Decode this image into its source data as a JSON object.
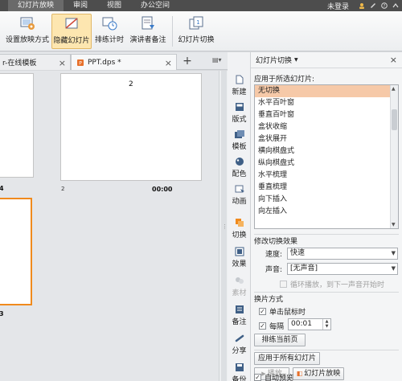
{
  "menu": {
    "items": [
      "幻灯片放映",
      "审阅",
      "视图",
      "办公空间"
    ],
    "active_index": 0,
    "login": "未登录"
  },
  "ribbon": {
    "buttons": [
      {
        "label": "设置放映方式",
        "icon": "slideshow-settings-icon"
      },
      {
        "label": "隐藏幻灯片",
        "icon": "hide-slide-icon",
        "selected": true
      },
      {
        "label": "排练计时",
        "icon": "rehearse-timing-icon"
      },
      {
        "label": "演讲者备注",
        "icon": "speaker-notes-icon"
      },
      {
        "label": "幻灯片切换",
        "icon": "slide-transition-icon"
      }
    ]
  },
  "tabs": [
    {
      "label": "r-在线模板",
      "active": false
    },
    {
      "label": "PPT.dps *",
      "active": true
    }
  ],
  "slides": {
    "slide2": {
      "number": "2",
      "index": "2",
      "time": "00:00"
    },
    "slide1_index_fragment": "4",
    "slide3_index_fragment": "3"
  },
  "sidebar": {
    "items": [
      {
        "label": "新建",
        "icon": "new-icon"
      },
      {
        "label": "版式",
        "icon": "layout-icon"
      },
      {
        "label": "模板",
        "icon": "template-icon"
      },
      {
        "label": "配色",
        "icon": "color-scheme-icon"
      },
      {
        "label": "动画",
        "icon": "animation-icon"
      },
      {
        "label": "切换",
        "icon": "transition-icon"
      },
      {
        "label": "效果",
        "icon": "effects-icon"
      },
      {
        "label": "素材",
        "icon": "materials-icon"
      },
      {
        "label": "备注",
        "icon": "notes-icon"
      },
      {
        "label": "分享",
        "icon": "share-icon"
      },
      {
        "label": "备份",
        "icon": "backup-icon"
      }
    ]
  },
  "pane": {
    "title": "幻灯片切换",
    "apply_label": "应用于所选幻灯片:",
    "transitions": [
      "无切换",
      "水平百叶窗",
      "垂直百叶窗",
      "盒状收缩",
      "盒状展开",
      "横向棋盘式",
      "纵向棋盘式",
      "水平梳理",
      "垂直梳理",
      "向下插入",
      "向左插入"
    ],
    "selected_transition": "无切换",
    "modify_label": "修改切换效果",
    "speed_label": "速度:",
    "speed_value": "快速",
    "sound_label": "声音:",
    "sound_value": "[无声音]",
    "loop_label": "循环播放，到下一声音开始时",
    "advance_label": "换片方式",
    "on_click_label": "单击鼠标时",
    "every_label": "每隔",
    "every_value": "00:01",
    "rehearse_current": "排练当前页",
    "apply_all": "应用于所有幻灯片",
    "play_label": "播放",
    "slideshow_label": "幻灯片放映",
    "auto_preview": "自动预览"
  }
}
